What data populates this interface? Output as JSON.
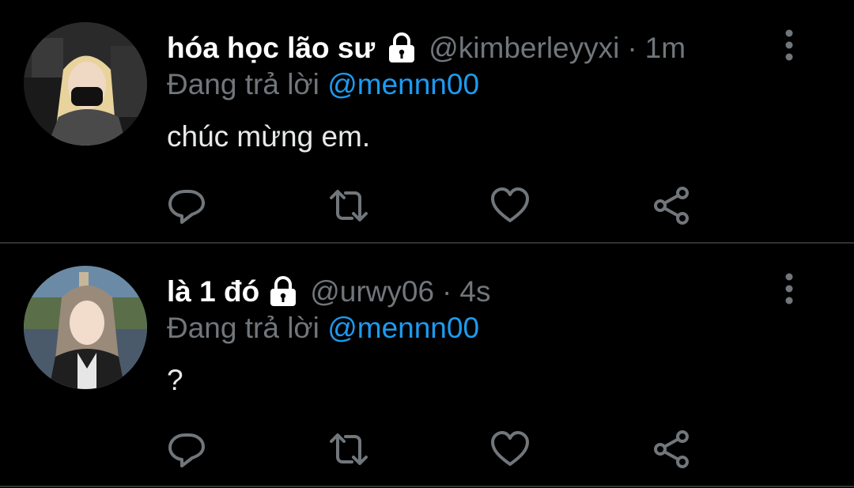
{
  "colors": {
    "background": "#000000",
    "primary_text": "#ffffff",
    "secondary_text": "#71767b",
    "link": "#1d9bf0",
    "divider": "#2f3336"
  },
  "tweets": [
    {
      "display_name": "hóa học lão sư",
      "protected_icon": "lock-icon",
      "handle": "@kimberleyyxi",
      "separator": "·",
      "time": "1m",
      "reply_prefix": "Đang trả lời",
      "reply_to": "@mennn00",
      "text": "chúc mừng em.",
      "avatar_icon": "avatar-photo",
      "actions": [
        "reply-icon",
        "retweet-icon",
        "like-icon",
        "share-icon"
      ],
      "menu_icon": "more-vertical-icon"
    },
    {
      "display_name": "là 1 đó",
      "protected_icon": "lock-icon",
      "handle": "@urwy06",
      "separator": "·",
      "time": "4s",
      "reply_prefix": "Đang trả lời",
      "reply_to": "@mennn00",
      "text": "?",
      "avatar_icon": "avatar-photo",
      "actions": [
        "reply-icon",
        "retweet-icon",
        "like-icon",
        "share-icon"
      ],
      "menu_icon": "more-vertical-icon"
    }
  ]
}
